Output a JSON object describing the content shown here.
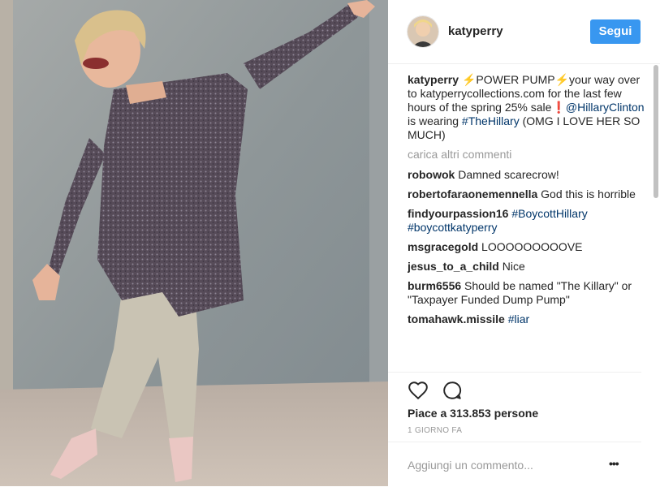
{
  "post": {
    "username": "katyperry",
    "follow_label": "Segui",
    "image_alt": "Photo of a woman in a metallic jacket with outstretched arms",
    "caption": {
      "username": "katyperry",
      "bolt": "⚡",
      "text_1": "POWER PUMP",
      "text_2": "your way over to katyperrycollections.com for the last few hours of the spring 25% sale",
      "excl": "❗",
      "mention": "@HillaryClinton",
      "text_3": " is wearing ",
      "hashtag": "#TheHillary",
      "text_4": " (OMG I LOVE HER SO MUCH)"
    },
    "load_more": "carica altri commenti",
    "comments": [
      {
        "user": "robowok",
        "text": "Damned scarecrow!",
        "tag": ""
      },
      {
        "user": "robertofaraonemennella",
        "text": "God this is horrible",
        "tag": ""
      },
      {
        "user": "findyourpassion16",
        "text": "",
        "tag": "#BoycottHillary #boycottkatyperry"
      },
      {
        "user": "msgracegold",
        "text": "LOOOOOOOOOVE",
        "tag": ""
      },
      {
        "user": "jesus_to_a_child",
        "text": "Nice",
        "tag": ""
      },
      {
        "user": "burm6556",
        "text": "Should be named \"The Killary\" or \"Taxpayer Funded Dump Pump\"",
        "tag": ""
      },
      {
        "user": "tomahawk.missile",
        "text": "",
        "tag": "#liar"
      }
    ],
    "likes": "Piace a 313.853 persone",
    "time": "1 GIORNO FA",
    "add_comment_placeholder": "Aggiungi un commento...",
    "more_options": "•••",
    "icons": {
      "like": "heart-icon",
      "comment": "comment-icon",
      "options": "more-options-icon"
    },
    "colors": {
      "accent": "#3897f0",
      "hashtag": "#003569",
      "muted": "#999999"
    }
  }
}
